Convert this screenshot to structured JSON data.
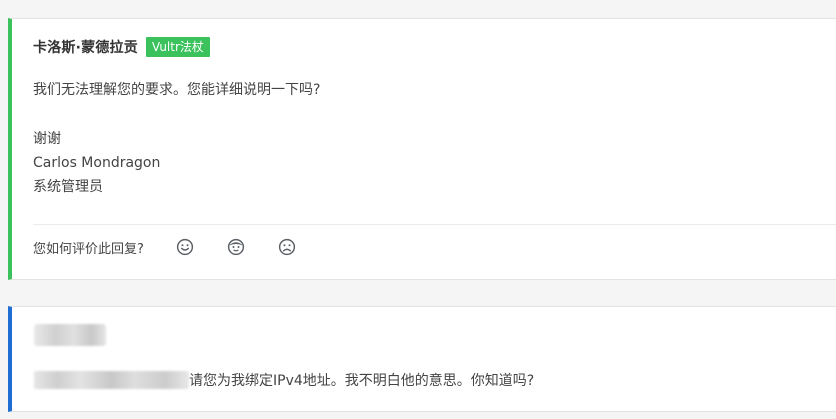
{
  "staff_reply": {
    "author": "卡洛斯·蒙德拉贡",
    "badge": "Vultr法杖",
    "accent_color": "#3bc25d",
    "body": {
      "line1": "我们无法理解您的要求。您能详细说明一下吗?",
      "thanks": "谢谢",
      "signature_name": "Carlos Mondragon",
      "signature_title": "系统管理员"
    },
    "rating": {
      "label": "您如何评价此回复?",
      "options": [
        "smile-face-icon",
        "neutral-face-icon",
        "frown-face-icon"
      ]
    }
  },
  "user_message": {
    "accent_color": "#1f6ed4",
    "text": "请您为我绑定IPv4地址。我不明白他的意思。你知道吗?"
  }
}
